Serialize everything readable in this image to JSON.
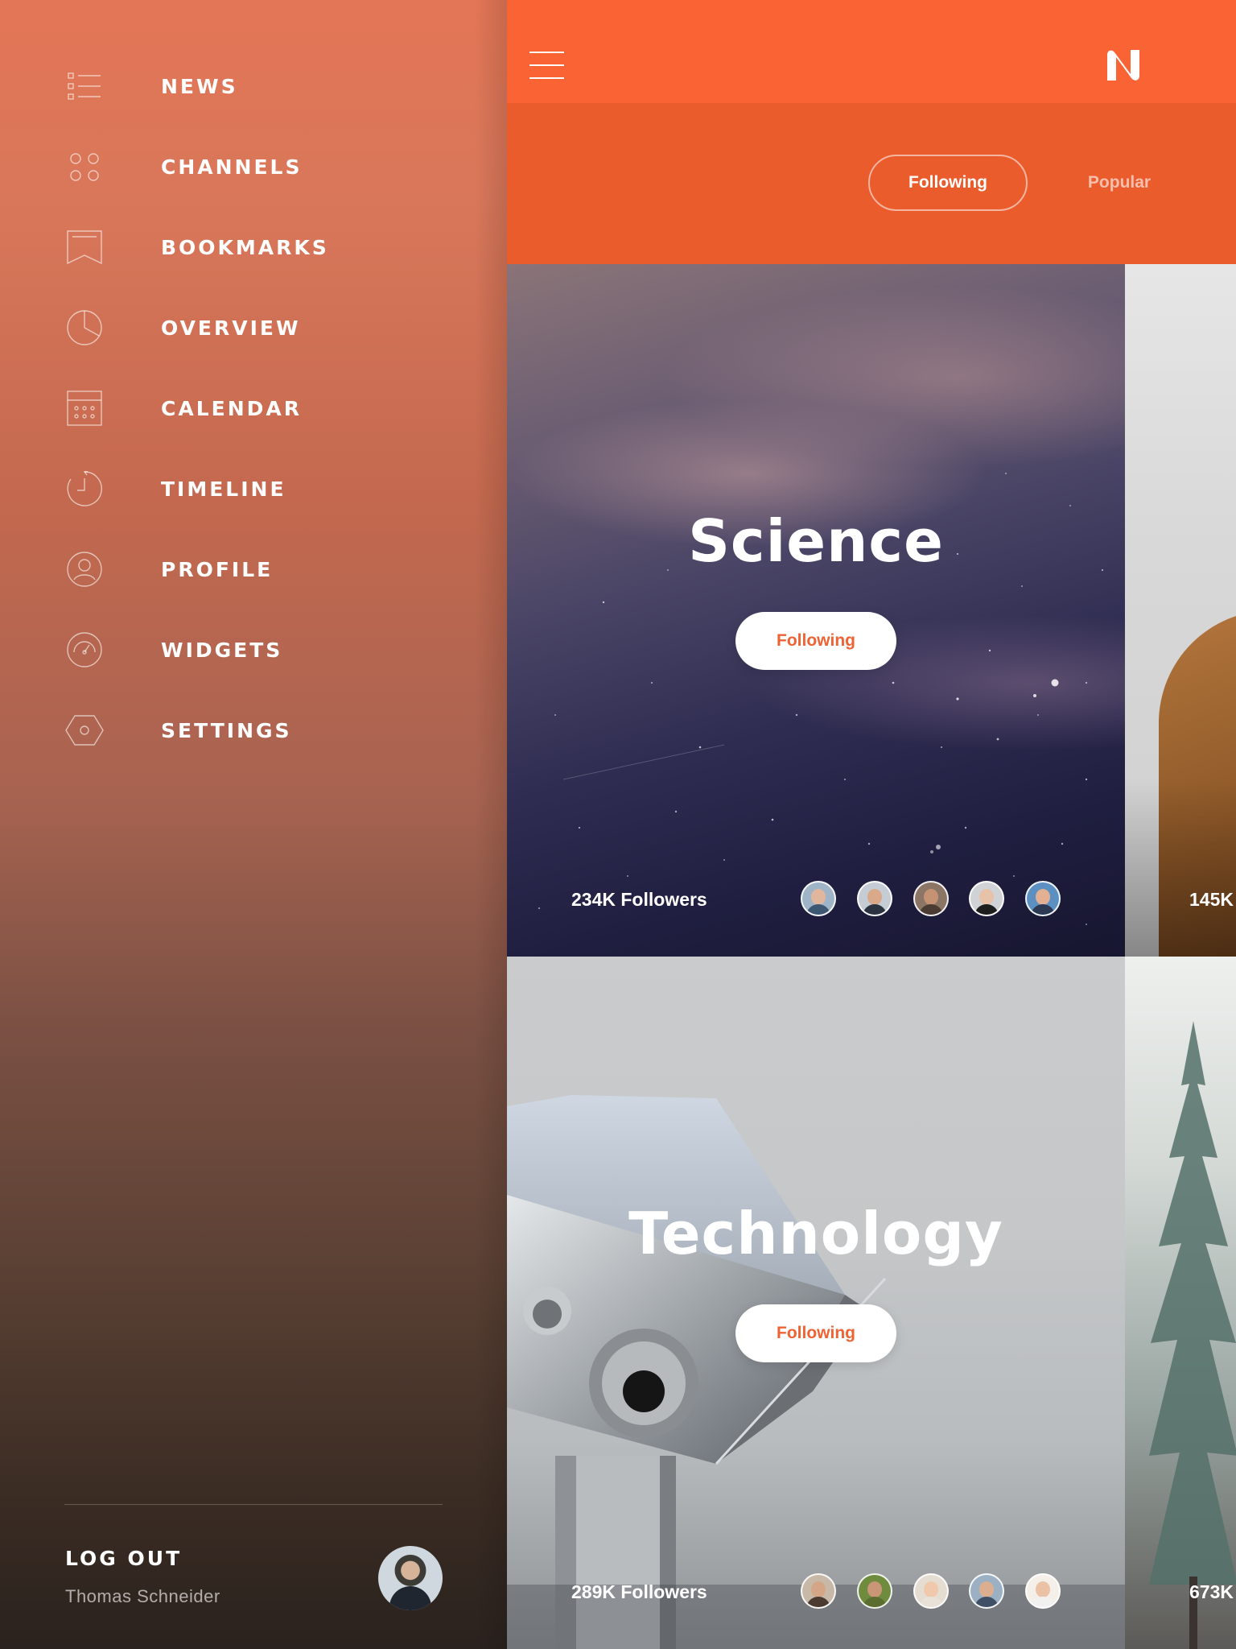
{
  "sidebar": {
    "items": [
      {
        "label": "NEWS",
        "icon": "list-icon"
      },
      {
        "label": "CHANNELS",
        "icon": "grid-dots-icon"
      },
      {
        "label": "BOOKMARKS",
        "icon": "bookmark-icon"
      },
      {
        "label": "OVERVIEW",
        "icon": "pie-chart-icon"
      },
      {
        "label": "CALENDAR",
        "icon": "calendar-icon"
      },
      {
        "label": "TIMELINE",
        "icon": "clock-icon"
      },
      {
        "label": "PROFILE",
        "icon": "user-icon"
      },
      {
        "label": "WIDGETS",
        "icon": "gauge-icon"
      },
      {
        "label": "SETTINGS",
        "icon": "hexagon-icon"
      }
    ],
    "logout_label": "LOG OUT",
    "user_name": "Thomas Schneider"
  },
  "header": {
    "menu_icon": "hamburger-icon",
    "logo_icon": "n-logo-icon",
    "tabs": [
      {
        "label": "Following",
        "active": true
      },
      {
        "label": "Popular",
        "active": false
      }
    ]
  },
  "channels": [
    {
      "title": "Science",
      "button_label": "Following",
      "followers": "234K Followers"
    },
    {
      "title": "Technology",
      "button_label": "Following",
      "followers": "289K Followers"
    }
  ],
  "peek_cards": [
    {
      "followers": "145K"
    },
    {
      "followers": "673K"
    }
  ],
  "colors": {
    "accent": "#fa6434",
    "tabbar": "#eb5c2d",
    "button_text": "#ef6234"
  }
}
